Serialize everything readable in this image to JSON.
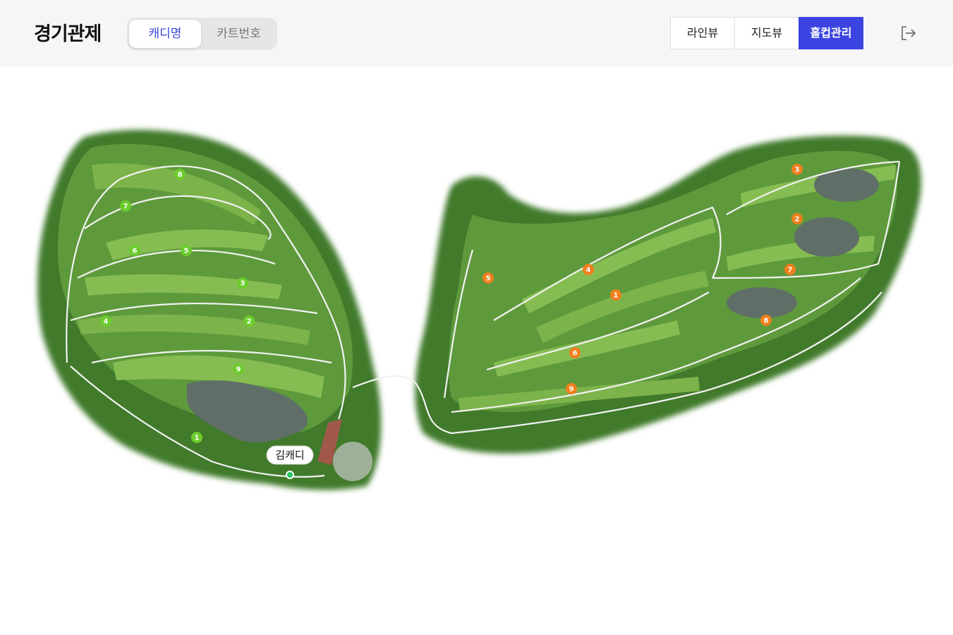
{
  "header": {
    "title": "경기관제",
    "mode_tabs": [
      {
        "label": "캐디명",
        "active": true
      },
      {
        "label": "카트번호",
        "active": false
      }
    ],
    "view_tabs": [
      {
        "label": "라인뷰",
        "active": false
      },
      {
        "label": "지도뷰",
        "active": false
      },
      {
        "label": "홀컵관리",
        "active": true
      }
    ],
    "logout_icon": "logout-icon"
  },
  "map": {
    "west_course": {
      "color": "#6ccc2c",
      "holes": [
        "1",
        "2",
        "3",
        "4",
        "5",
        "6",
        "7",
        "8",
        "9"
      ]
    },
    "east_course": {
      "color": "#f07f1e",
      "holes": [
        "1",
        "2",
        "3",
        "4",
        "5",
        "6",
        "7",
        "8",
        "9"
      ]
    },
    "caddie_marker": {
      "name": "김캐디",
      "status_color": "#22c55e"
    }
  },
  "colors": {
    "accent": "#3b44e0",
    "header_bg": "#f6f6f7"
  }
}
